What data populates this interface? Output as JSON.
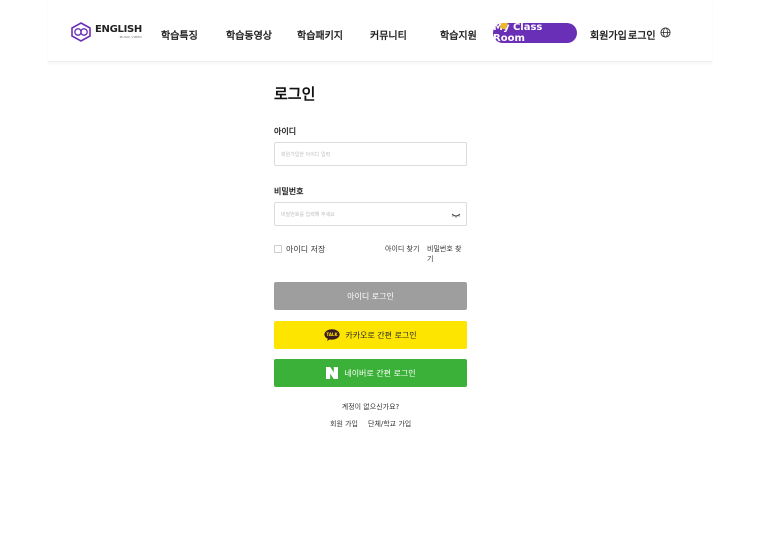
{
  "header": {
    "logo": {
      "main": "ENGLISH",
      "sub": "MUSIC VIDEO",
      "mark": "K"
    },
    "nav": [
      "학습특징",
      "학습동영상",
      "학습패키지",
      "커뮤니티",
      "학습지원"
    ],
    "my_class": "My Class Room",
    "signup": "회원가입",
    "login": "로그인",
    "language_icon": "globe-icon",
    "accent_color": "#6a2fb7"
  },
  "login": {
    "title": "로그인",
    "id_label": "아이디",
    "id_placeholder": "회원가입한 아이디 입력",
    "pw_label": "비밀번호",
    "pw_placeholder": "비밀번호를 입력해 주세요",
    "pw_icon": "eye-toggle-icon",
    "save_id": "아이디 저장",
    "find_id": "아이디 찾기",
    "find_pw": "비밀번호 찾기",
    "id_login_button": "아이디 로그인",
    "kakao_button": "카카오로 간편 로그인",
    "kakao_badge": "TALK",
    "naver_button": "네이버로 간편 로그인",
    "no_account": "계정이 없으신가요?",
    "join_member": "회원 가입",
    "join_group": "단체/학교 가입",
    "colors": {
      "kakao": "#fee500",
      "naver": "#3cb139",
      "id_button": "#9e9e9e"
    }
  }
}
